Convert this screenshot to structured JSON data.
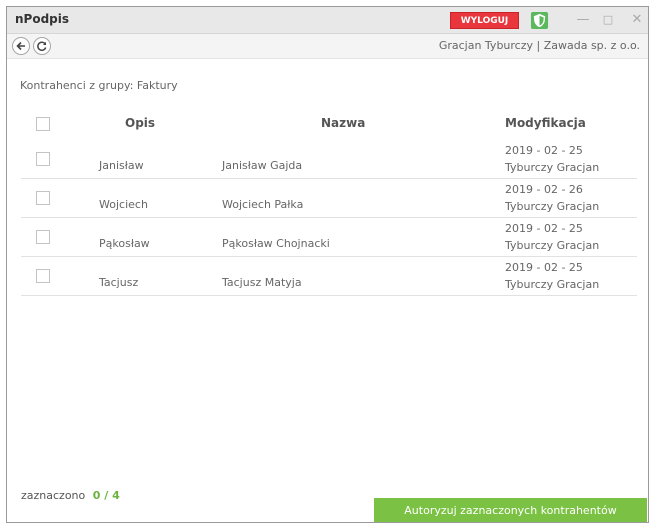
{
  "titlebar": {
    "app_title": "nPodpis",
    "logout_label": "WYLOGUJ",
    "minimize_glyph": "—",
    "maximize_glyph": "□",
    "close_glyph": "✕",
    "shield_color": "#5cb85c",
    "logout_color": "#e8363c"
  },
  "navbar": {
    "back_icon": "back-arrow-icon",
    "refresh_icon": "refresh-icon",
    "user_info": "Gracjan Tyburczy | Zawada sp. z o.o."
  },
  "content": {
    "group_label": "Kontrahenci z grupy: Faktury",
    "columns": [
      "Opis",
      "Nazwa",
      "Modyfikacja"
    ],
    "rows": [
      {
        "opis": "Janisław",
        "nazwa": "Janisław Gajda",
        "date": "2019 - 02 - 25",
        "user": "Tyburczy Gracjan"
      },
      {
        "opis": "Wojciech",
        "nazwa": "Wojciech Pałka",
        "date": "2019 - 02 - 26",
        "user": "Tyburczy Gracjan"
      },
      {
        "opis": "Pąkosław",
        "nazwa": "Pąkosław Chojnacki",
        "date": "2019 - 02 - 25",
        "user": "Tyburczy Gracjan"
      },
      {
        "opis": "Tacjusz",
        "nazwa": "Tacjusz Matyja",
        "date": "2019 - 02 - 25",
        "user": "Tyburczy Gracjan"
      }
    ]
  },
  "footer": {
    "selected_label": "zaznaczono",
    "selected_count": "0 / 4",
    "authorize_label": "Autoryzuj zaznaczonych kontrahentów",
    "accent_color": "#7bc143"
  }
}
